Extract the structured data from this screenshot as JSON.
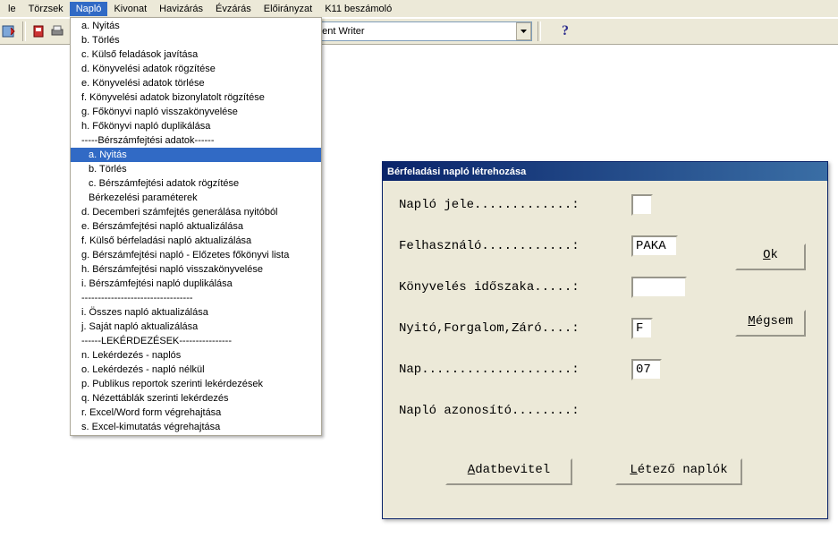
{
  "menubar": {
    "items": [
      "le",
      "Törzsek",
      "Napló",
      "Kivonat",
      "Havizárás",
      "Évzárás",
      "Előirányzat",
      "K11 beszámoló"
    ],
    "open_index": 2
  },
  "toolbar": {
    "combo_value": "nent Writer"
  },
  "dropdown": {
    "items": [
      {
        "t": "a. Nyitás"
      },
      {
        "t": "b. Törlés"
      },
      {
        "t": "c. Külső feladások javítása"
      },
      {
        "t": "d. Könyvelési adatok rögzítése"
      },
      {
        "t": "e. Könyvelési adatok törlése"
      },
      {
        "t": "f. Könyvelési adatok bizonylatolt rögzítése"
      },
      {
        "t": "g. Főkönyvi napló visszakönyvelése"
      },
      {
        "t": "h. Főkönyvi napló duplikálása"
      },
      {
        "t": "-----Bérszámfejtési adatok------"
      },
      {
        "t": "a. Nyitás",
        "sub": true,
        "hover": true
      },
      {
        "t": "b. Törlés",
        "sub": true
      },
      {
        "t": "c. Bérszámfejtési adatok rögzítése",
        "sub": true
      },
      {
        "t": "Bérkezelési paraméterek",
        "sub": true
      },
      {
        "t": "d. Decemberi számfejtés generálása nyitóból"
      },
      {
        "t": "e. Bérszámfejtési napló aktualizálása"
      },
      {
        "t": "f. Külső bérfeladási napló aktualizálása"
      },
      {
        "t": "g. Bérszámfejtési napló - Előzetes főkönyvi lista"
      },
      {
        "t": "h. Bérszámfejtési napló visszakönyvelése"
      },
      {
        "t": "i. Bérszámfejtési napló duplikálása"
      },
      {
        "t": "----------------------------------"
      },
      {
        "t": "i. Összes napló aktualizálása"
      },
      {
        "t": "j. Saját napló aktualizálása"
      },
      {
        "t": "------LEKÉRDEZÉSEK----------------"
      },
      {
        "t": "n. Lekérdezés - naplós"
      },
      {
        "t": "o. Lekérdezés - napló nélkül"
      },
      {
        "t": "p. Publikus reportok szerinti lekérdezések"
      },
      {
        "t": "q. Nézettáblák szerinti lekérdezés"
      },
      {
        "t": "r. Excel/Word form végrehajtása"
      },
      {
        "t": "s. Excel-kimutatás végrehajtása"
      }
    ]
  },
  "dialog": {
    "title": "Bérfeladási napló létrehozása",
    "fields": {
      "naplo_jele_label": "Napló jele.............:",
      "felhasznalo_label": "Felhasználó............:",
      "felhasznalo_value": "PAKA",
      "konyv_label": "Könyvelés időszaka.....:",
      "nfz_label": "Nyitó,Forgalom,Záró....:",
      "nfz_value": "F",
      "nap_label": "Nap....................:",
      "nap_value": "07",
      "azon_label": "Napló azonosító........:"
    },
    "buttons": {
      "ok": "Ok",
      "cancel": "Mégsem",
      "adatbevitel_pre": "A",
      "adatbevitel_rest": "datbevitel",
      "letezo_pre": "L",
      "letezo_rest": "étező naplók",
      "cancel_pre": "M",
      "cancel_rest": "égsem",
      "ok_pre": "O",
      "ok_rest": "k"
    }
  }
}
